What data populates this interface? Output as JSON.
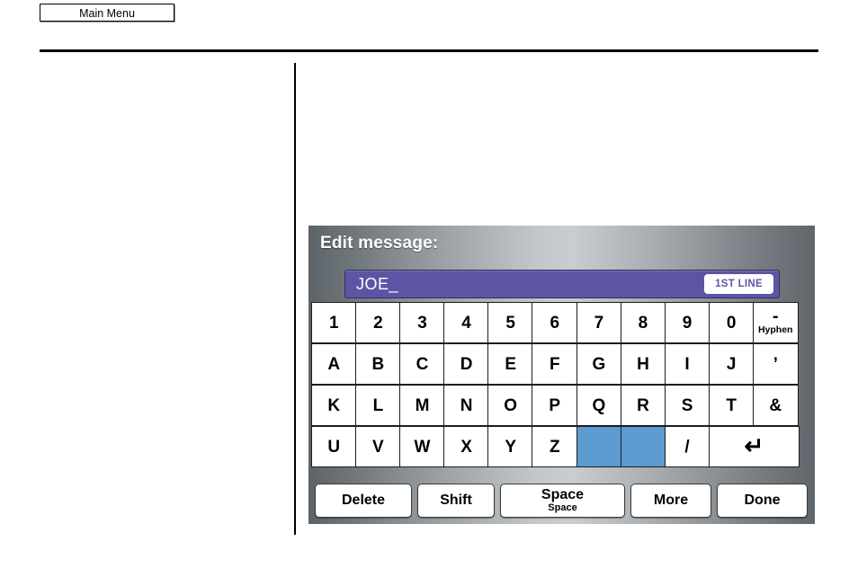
{
  "page": {
    "main_menu_label": "Main Menu"
  },
  "dialog": {
    "title": "Edit message:",
    "field": {
      "value": "JOE_",
      "placeholder": "",
      "line_badge": "1ST LINE",
      "field_color": "#5d55a4",
      "badge_text_color": "#5d55a4"
    },
    "highlight_color": "#5b9bd0",
    "rows": [
      [
        {
          "label": "1"
        },
        {
          "label": "2"
        },
        {
          "label": "3"
        },
        {
          "label": "4"
        },
        {
          "label": "5"
        },
        {
          "label": "6"
        },
        {
          "label": "7"
        },
        {
          "label": "8"
        },
        {
          "label": "9"
        },
        {
          "label": "0"
        },
        {
          "label": "-",
          "sub": "Hyphen"
        }
      ],
      [
        {
          "label": "A"
        },
        {
          "label": "B"
        },
        {
          "label": "C"
        },
        {
          "label": "D"
        },
        {
          "label": "E"
        },
        {
          "label": "F"
        },
        {
          "label": "G"
        },
        {
          "label": "H"
        },
        {
          "label": "I"
        },
        {
          "label": "J"
        },
        {
          "label": "’"
        }
      ],
      [
        {
          "label": "K"
        },
        {
          "label": "L"
        },
        {
          "label": "M"
        },
        {
          "label": "N"
        },
        {
          "label": "O"
        },
        {
          "label": "P"
        },
        {
          "label": "Q"
        },
        {
          "label": "R"
        },
        {
          "label": "S"
        },
        {
          "label": "T"
        },
        {
          "label": "&"
        }
      ],
      [
        {
          "label": "U"
        },
        {
          "label": "V"
        },
        {
          "label": "W"
        },
        {
          "label": "X"
        },
        {
          "label": "Y"
        },
        {
          "label": "Z"
        },
        {
          "label": ""
        },
        {
          "label": ""
        },
        {
          "label": "/"
        },
        {
          "label": "↵"
        }
      ]
    ],
    "function_keys": [
      {
        "label": "Delete",
        "sub": ""
      },
      {
        "label": "Shift",
        "sub": ""
      },
      {
        "label": "Space",
        "sub": "Space"
      },
      {
        "label": "More",
        "sub": ""
      },
      {
        "label": "Done",
        "sub": ""
      }
    ]
  }
}
